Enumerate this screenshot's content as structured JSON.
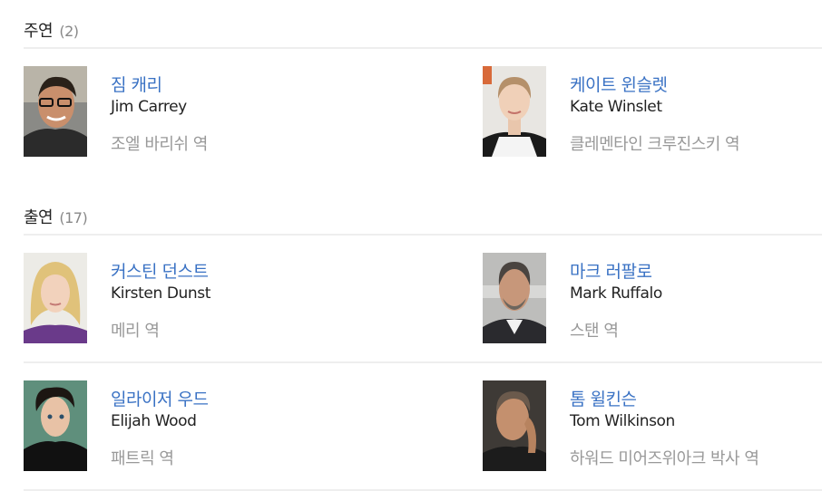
{
  "sections": [
    {
      "title": "주연",
      "count": "(2)",
      "people": [
        {
          "name_ko": "짐 캐리",
          "name_en": "Jim Carrey",
          "role": "조엘 바리쉬 역"
        },
        {
          "name_ko": "케이트 윈슬렛",
          "name_en": "Kate Winslet",
          "role": "클레멘타인 크루진스키 역"
        }
      ]
    },
    {
      "title": "출연",
      "count": "(17)",
      "people": [
        {
          "name_ko": "커스틴 던스트",
          "name_en": "Kirsten Dunst",
          "role": "메리 역"
        },
        {
          "name_ko": "마크 러팔로",
          "name_en": "Mark Ruffalo",
          "role": "스탠 역"
        },
        {
          "name_ko": "일라이저 우드",
          "name_en": "Elijah Wood",
          "role": "패트릭 역"
        },
        {
          "name_ko": "톰 윌킨슨",
          "name_en": "Tom Wilkinson",
          "role": "하워드 미어즈위아크 박사 역"
        }
      ]
    }
  ],
  "colors": {
    "link": "#3a72c4",
    "muted": "#999999",
    "divider": "#eeeeee"
  }
}
